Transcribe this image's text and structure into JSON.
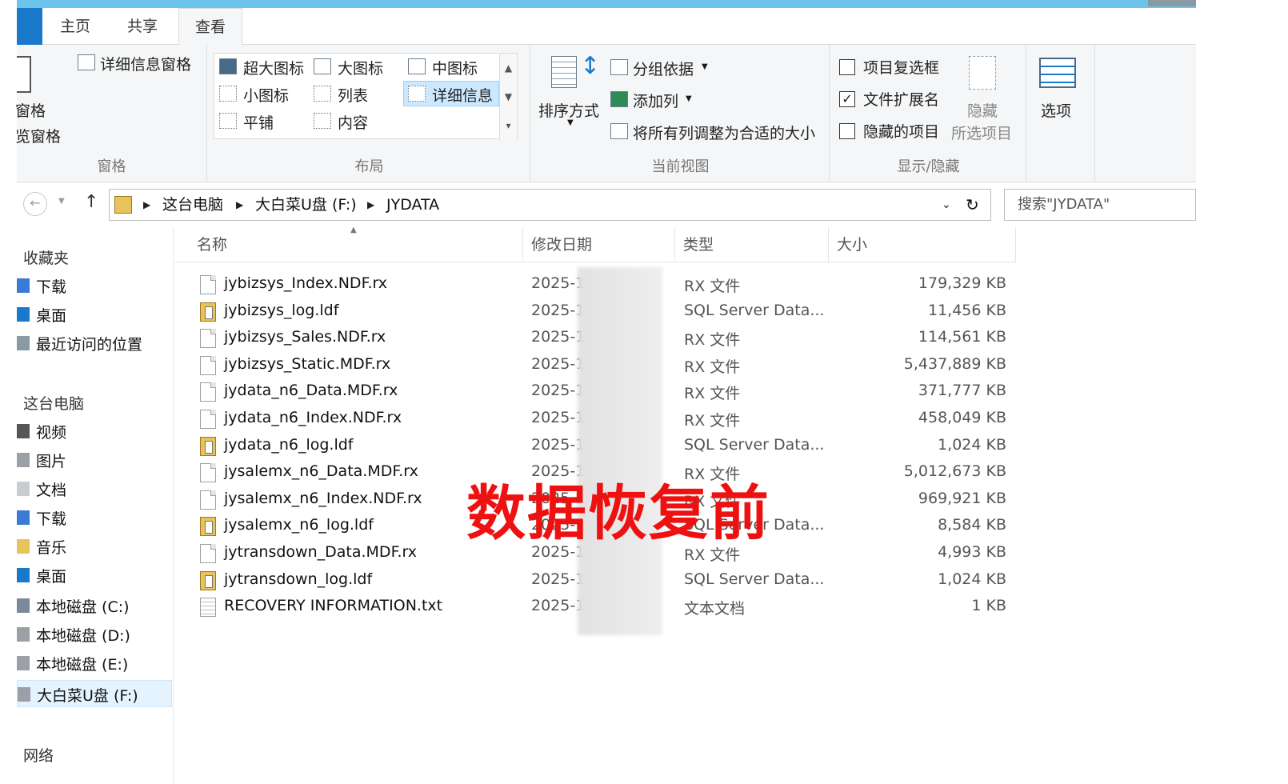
{
  "tabs": [
    "主页",
    "共享",
    "查看"
  ],
  "active_tab": "查看",
  "ribbon": {
    "pane_group": {
      "label": "窗格",
      "details_pane": "详细信息窗格",
      "nav_pane_partial": "窗格",
      "preview_pane_partial": "览窗格"
    },
    "layout_group": {
      "label": "布局",
      "items": [
        "超大图标",
        "大图标",
        "中图标",
        "小图标",
        "列表",
        "详细信息",
        "平铺",
        "内容"
      ],
      "selected": "详细信息"
    },
    "current_view_group": {
      "label": "当前视图",
      "sort_by": "排序方式",
      "group_by": "分组依据",
      "add_column": "添加列",
      "size_all_columns": "将所有列调整为合适的大小"
    },
    "show_hide_group": {
      "label": "显示/隐藏",
      "item_checkboxes": "项目复选框",
      "item_checkboxes_checked": false,
      "file_extensions": "文件扩展名",
      "file_extensions_checked": true,
      "hidden_items": "隐藏的项目",
      "hidden_items_checked": false,
      "hide_selected_line1": "隐藏",
      "hide_selected_line2": "所选项目"
    },
    "options": "选项"
  },
  "address": {
    "crumbs": [
      "这台电脑",
      "大白菜U盘 (F:)",
      "JYDATA"
    ],
    "search_placeholder": "搜索\"JYDATA\""
  },
  "nav_pane": {
    "favorites_head": "收藏夹",
    "favorites": [
      "下载",
      "桌面",
      "最近访问的位置"
    ],
    "thispc_head": "这台电脑",
    "thispc": [
      "视频",
      "图片",
      "文档",
      "下载",
      "音乐",
      "桌面",
      "本地磁盘 (C:)",
      "本地磁盘 (D:)",
      "本地磁盘 (E:)",
      "大白菜U盘 (F:)"
    ],
    "selected": "大白菜U盘 (F:)",
    "network_head": "网络"
  },
  "columns": [
    "名称",
    "修改日期",
    "类型",
    "大小"
  ],
  "files": [
    {
      "name": "jybizsys_Index.NDF.rx",
      "date": "2025-1",
      "type": "RX 文件",
      "size": "179,329 KB",
      "icon": "doc"
    },
    {
      "name": "jybizsys_log.ldf",
      "date": "2025-1",
      "type": "SQL Server Data...",
      "size": "11,456 KB",
      "icon": "ldf"
    },
    {
      "name": "jybizsys_Sales.NDF.rx",
      "date": "2025-1",
      "type": "RX 文件",
      "size": "114,561 KB",
      "icon": "doc"
    },
    {
      "name": "jybizsys_Static.MDF.rx",
      "date": "2025-1",
      "type": "RX 文件",
      "size": "5,437,889 KB",
      "icon": "doc"
    },
    {
      "name": "jydata_n6_Data.MDF.rx",
      "date": "2025-1",
      "type": "RX 文件",
      "size": "371,777 KB",
      "icon": "doc"
    },
    {
      "name": "jydata_n6_Index.NDF.rx",
      "date": "2025-1",
      "type": "RX 文件",
      "size": "458,049 KB",
      "icon": "doc"
    },
    {
      "name": "jydata_n6_log.ldf",
      "date": "2025-1",
      "type": "SQL Server Data...",
      "size": "1,024 KB",
      "icon": "ldf"
    },
    {
      "name": "jysalemx_n6_Data.MDF.rx",
      "date": "2025-1",
      "type": "RX 文件",
      "size": "5,012,673 KB",
      "icon": "doc"
    },
    {
      "name": "jysalemx_n6_Index.NDF.rx",
      "date": "2025-1",
      "type": "RX 文件",
      "size": "969,921 KB",
      "icon": "doc"
    },
    {
      "name": "jysalemx_n6_log.ldf",
      "date": "2025-1",
      "type": "SQL Server Data...",
      "size": "8,584 KB",
      "icon": "ldf"
    },
    {
      "name": "jytransdown_Data.MDF.rx",
      "date": "2025-1",
      "type": "RX 文件",
      "size": "4,993 KB",
      "icon": "doc"
    },
    {
      "name": "jytransdown_log.ldf",
      "date": "2025-1",
      "type": "SQL Server Data...",
      "size": "1,024 KB",
      "icon": "ldf"
    },
    {
      "name": "RECOVERY INFORMATION.txt",
      "date": "2025-1",
      "type": "文本文档",
      "size": "1 KB",
      "icon": "txt"
    }
  ],
  "overlay_text": "数据恢复前"
}
